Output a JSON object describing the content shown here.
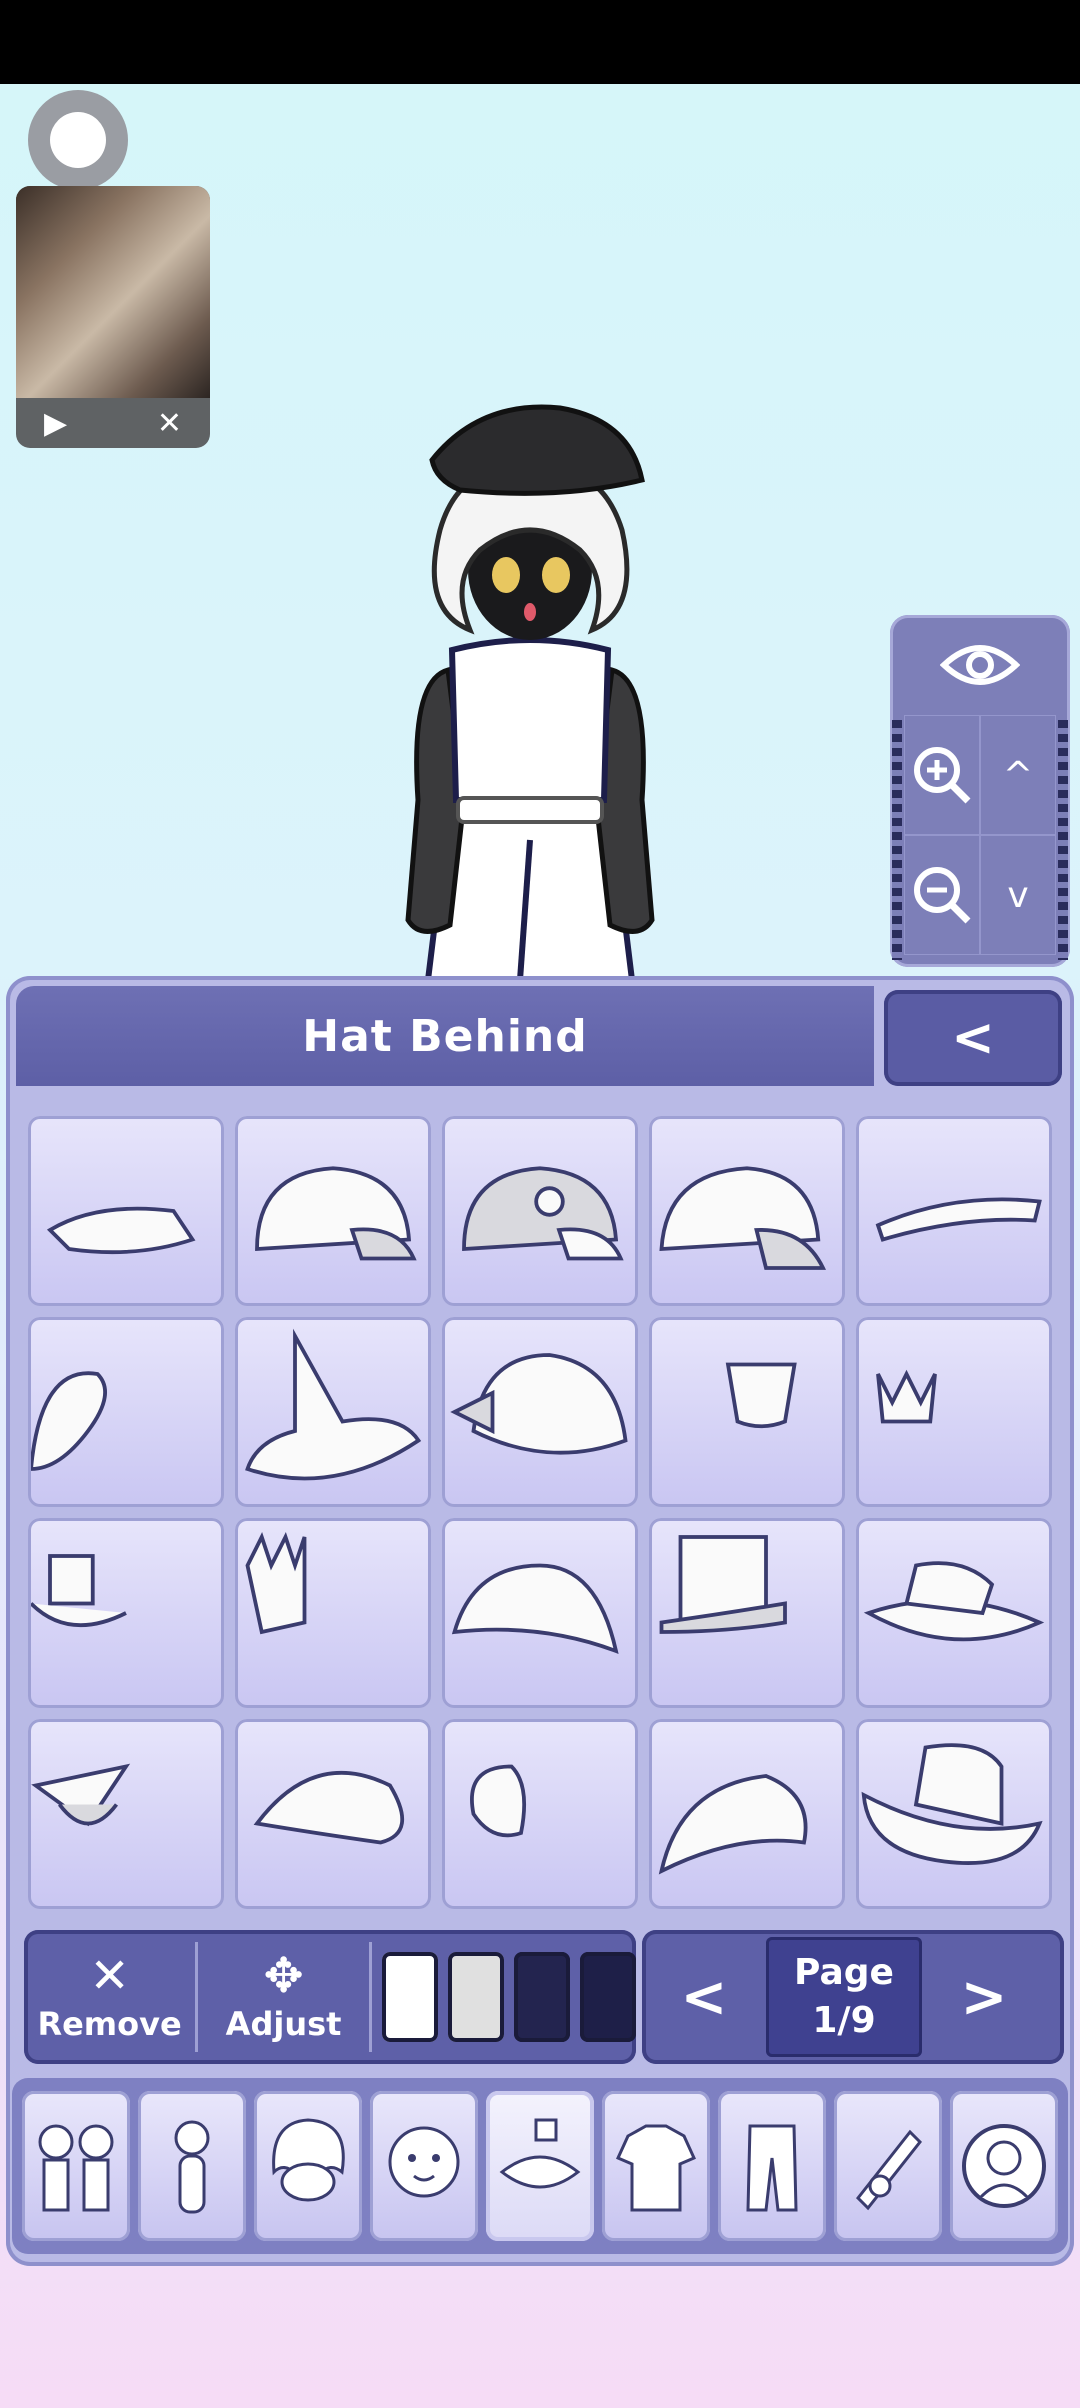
{
  "panel": {
    "title": "Hat Behind",
    "back_label": "<"
  },
  "items": [
    {
      "icon": "visor-hat-icon"
    },
    {
      "icon": "baseball-cap-icon"
    },
    {
      "icon": "cap-with-emblem-icon"
    },
    {
      "icon": "baseball-cap-side-icon"
    },
    {
      "icon": "visor-flat-icon"
    },
    {
      "icon": "beret-partial-icon"
    },
    {
      "icon": "witch-hat-icon"
    },
    {
      "icon": "ribbon-sunhat-icon"
    },
    {
      "icon": "small-fez-icon"
    },
    {
      "icon": "small-crown-icon"
    },
    {
      "icon": "mini-top-hat-icon"
    },
    {
      "icon": "tall-crown-icon"
    },
    {
      "icon": "bucket-hat-icon"
    },
    {
      "icon": "top-hat-icon"
    },
    {
      "icon": "wide-brim-hat-icon"
    },
    {
      "icon": "graduation-cap-icon"
    },
    {
      "icon": "flat-cap-icon"
    },
    {
      "icon": "chef-hat-icon"
    },
    {
      "icon": "newsboy-cap-icon"
    },
    {
      "icon": "cowboy-hat-icon"
    }
  ],
  "tools": {
    "remove_label": "Remove",
    "adjust_label": "Adjust",
    "swatches": [
      "#ffffff",
      "#e0e0e0",
      "#23244f",
      "#1e1f48"
    ]
  },
  "pager": {
    "prev": "<",
    "next": ">",
    "page_label": "Page",
    "page_value": "1/9"
  },
  "categories": [
    {
      "icon": "couple-preset-icon"
    },
    {
      "icon": "body-icon"
    },
    {
      "icon": "hair-icon"
    },
    {
      "icon": "face-icon"
    },
    {
      "icon": "accessories-icon",
      "active": true
    },
    {
      "icon": "shirt-icon"
    },
    {
      "icon": "pants-icon"
    },
    {
      "icon": "weapon-props-icon"
    },
    {
      "icon": "profile-icon"
    }
  ]
}
